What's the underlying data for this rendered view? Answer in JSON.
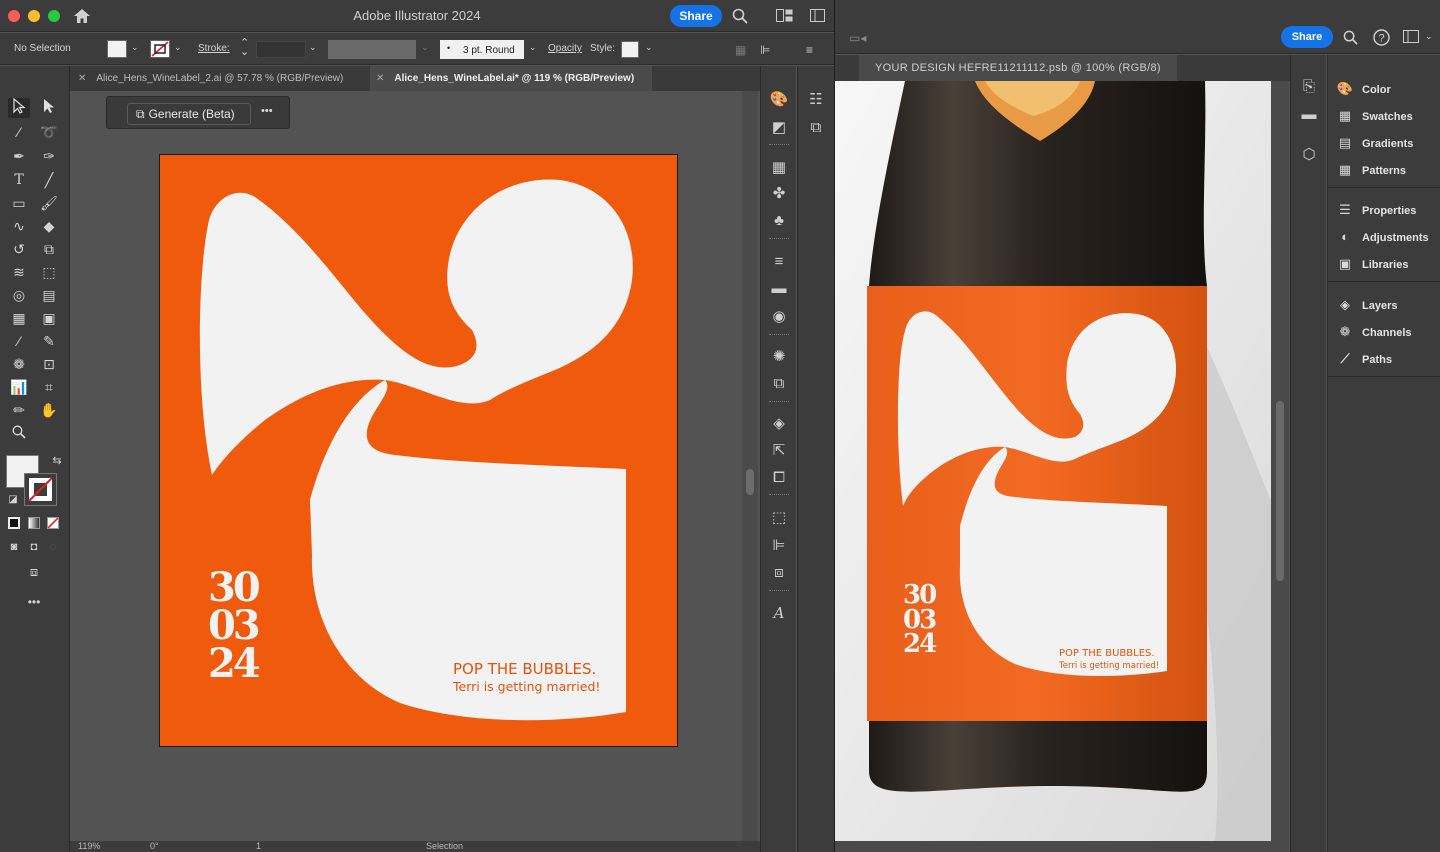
{
  "illustrator": {
    "title": "Adobe Illustrator 2024",
    "share_label": "Share",
    "control": {
      "selection": "No Selection",
      "stroke_label": "Stroke:",
      "brush_label": "3 pt. Round",
      "opacity_label": "Opacity",
      "style_label": "Style:"
    },
    "tabs": [
      {
        "label": "Alice_Hens_WineLabel_2.ai @ 57.78 % (RGB/Preview)",
        "active": false
      },
      {
        "label": "Alice_Hens_WineLabel.ai* @ 119 % (RGB/Preview)",
        "active": true
      }
    ],
    "generate_label": "Generate (Beta)",
    "more_label": "•••",
    "artwork": {
      "date_lines": [
        "30",
        "03",
        "24"
      ],
      "headline": "POP THE BUBBLES.",
      "subline": "Terri is getting married!",
      "label_color": "#ef5a0d",
      "shape_color": "#f2f2f2"
    },
    "status": {
      "zoom": "119%",
      "angle": "0°",
      "artboard": "1",
      "tool": "Selection"
    }
  },
  "photoshop": {
    "share_label": "Share",
    "doc_tab": "YOUR DESIGN HEFRE11211112.psb @ 100% (RGB/8)",
    "mockup": {
      "date_lines": [
        "30",
        "03",
        "24"
      ],
      "headline": "POP THE BUBBLES.",
      "subline": "Terri is getting married!"
    },
    "panels": [
      {
        "label": "Color",
        "icon": "palette-icon"
      },
      {
        "label": "Swatches",
        "icon": "grid-icon"
      },
      {
        "label": "Gradients",
        "icon": "gradient-icon"
      },
      {
        "label": "Patterns",
        "icon": "pattern-icon"
      },
      {
        "label": "Properties",
        "icon": "sliders-icon"
      },
      {
        "label": "Adjustments",
        "icon": "adjust-icon"
      },
      {
        "label": "Libraries",
        "icon": "library-icon"
      },
      {
        "label": "Layers",
        "icon": "layers-icon"
      },
      {
        "label": "Channels",
        "icon": "channels-icon"
      },
      {
        "label": "Paths",
        "icon": "paths-icon"
      }
    ]
  }
}
